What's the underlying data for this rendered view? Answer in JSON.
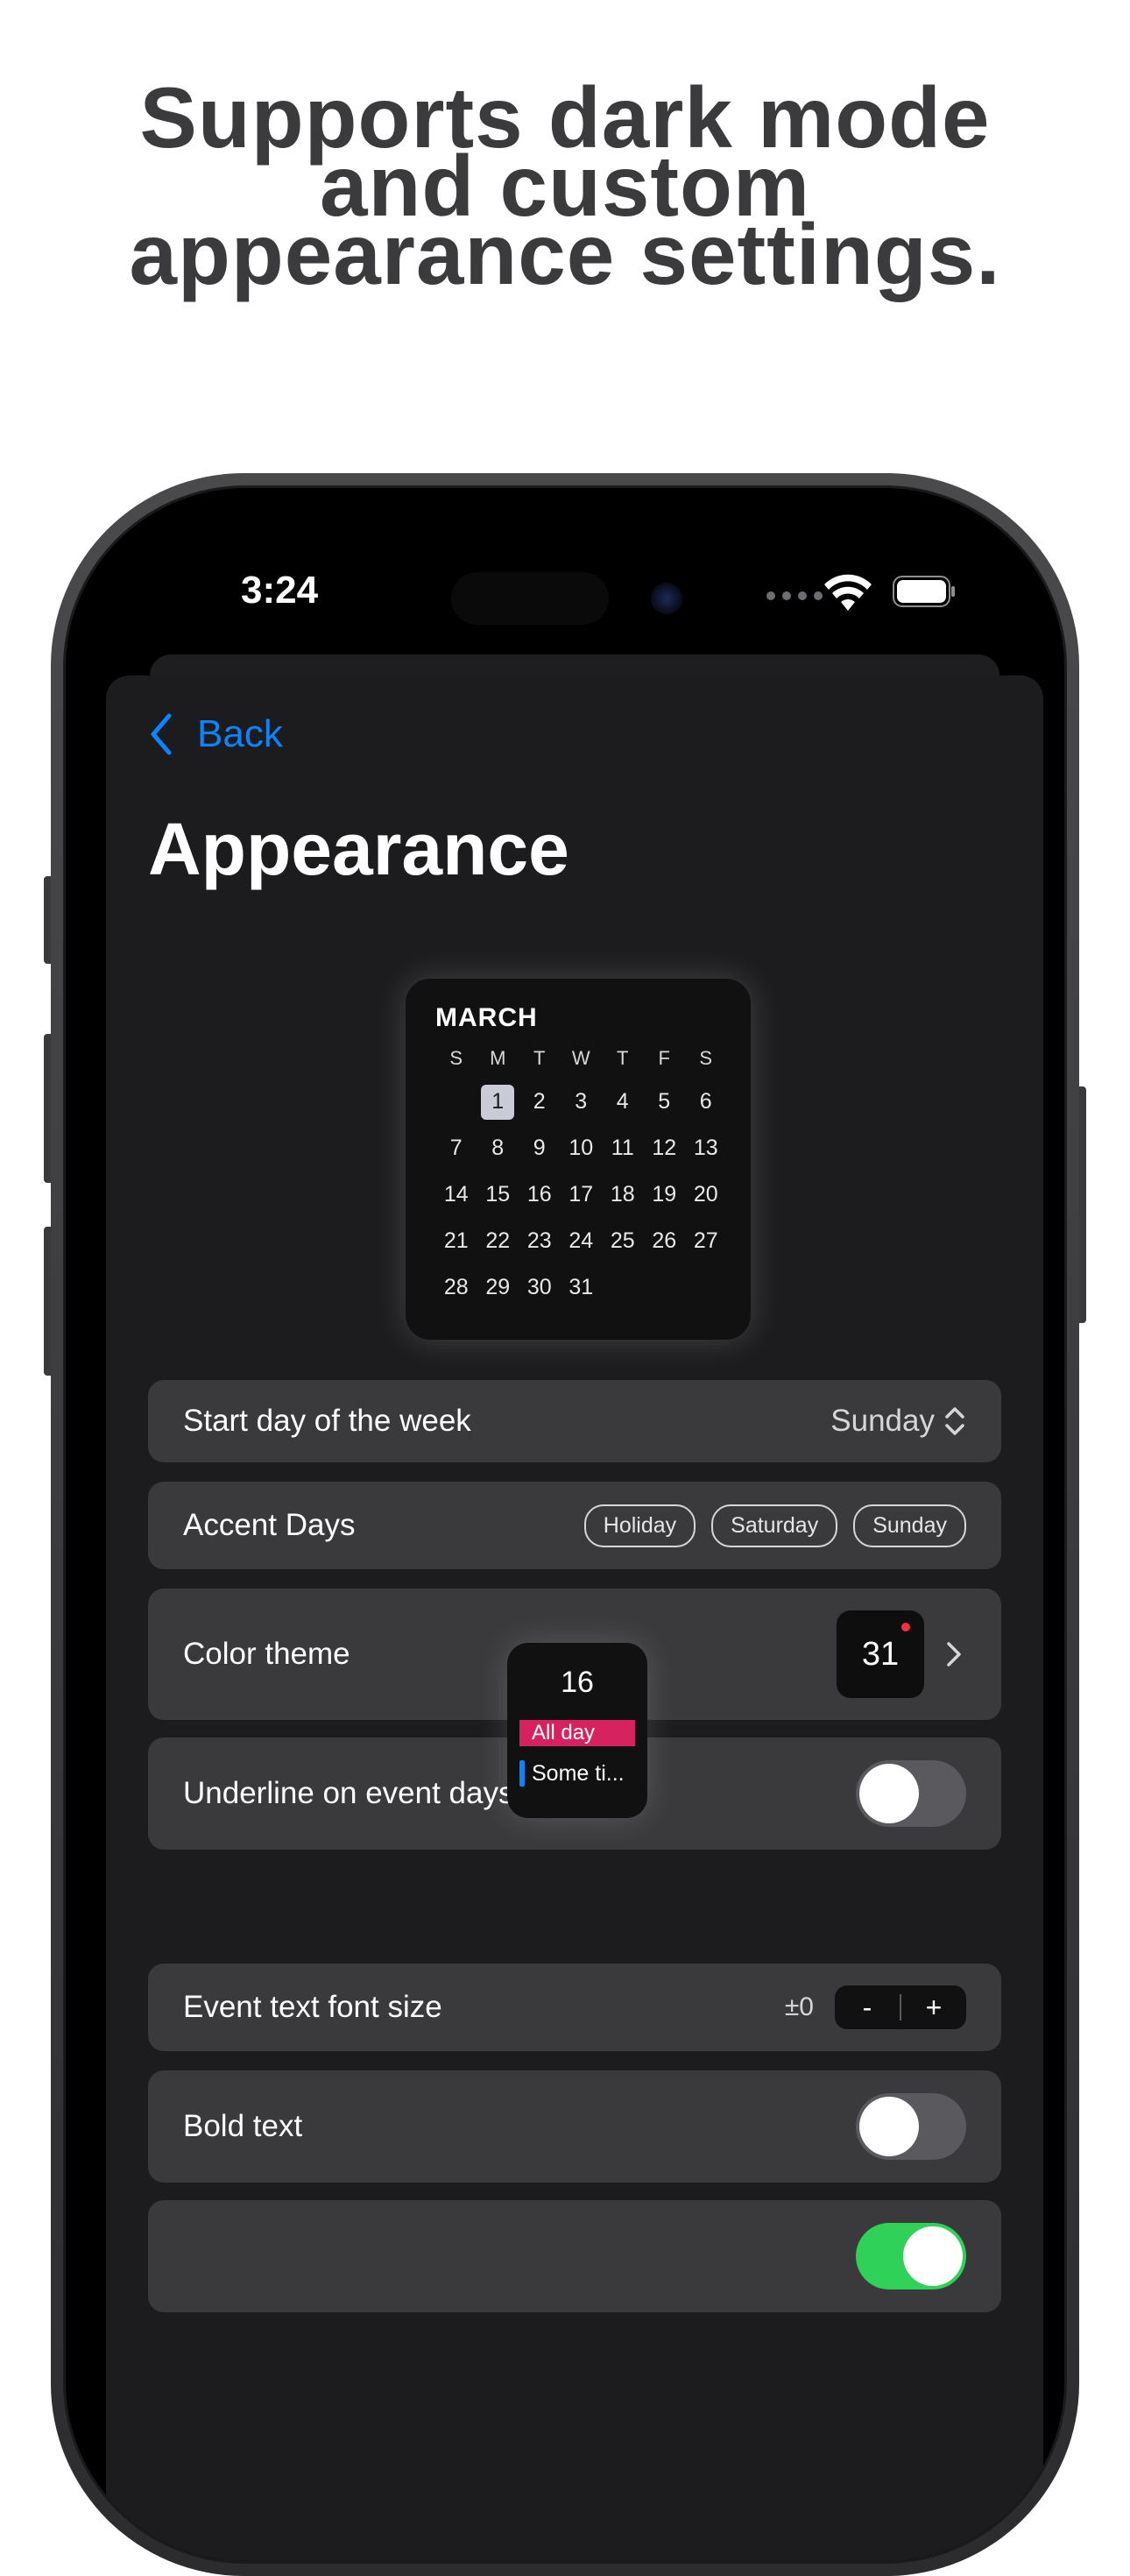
{
  "headline": {
    "line1": "Supports dark mode",
    "line2": "and custom",
    "line3": "appearance settings."
  },
  "status_bar": {
    "time": "3:24"
  },
  "nav": {
    "back_label": "Back"
  },
  "page": {
    "title": "Appearance"
  },
  "calendar_preview": {
    "month": "MARCH",
    "weekdays": [
      "S",
      "M",
      "T",
      "W",
      "T",
      "F",
      "S"
    ],
    "leading_blanks": 1,
    "days": 31,
    "today": 1
  },
  "settings": {
    "start_day": {
      "label": "Start day of the week",
      "value": "Sunday"
    },
    "accent_days": {
      "label": "Accent Days",
      "options": [
        "Holiday",
        "Saturday",
        "Sunday"
      ]
    },
    "color_theme": {
      "label": "Color theme",
      "tile_number": "31"
    },
    "underline": {
      "label": "Underline on event days",
      "on": false
    },
    "font_size": {
      "label": "Event text font size",
      "value": "±0",
      "minus": "-",
      "plus": "+"
    },
    "bold_text": {
      "label": "Bold text",
      "on": false
    }
  },
  "event_preview": {
    "date": "16",
    "allday_label": "All day",
    "timed_label": "Some ti..."
  },
  "colors": {
    "accent": "#0a84ff",
    "allday": "#d6225e",
    "toggle_on": "#30d158"
  }
}
